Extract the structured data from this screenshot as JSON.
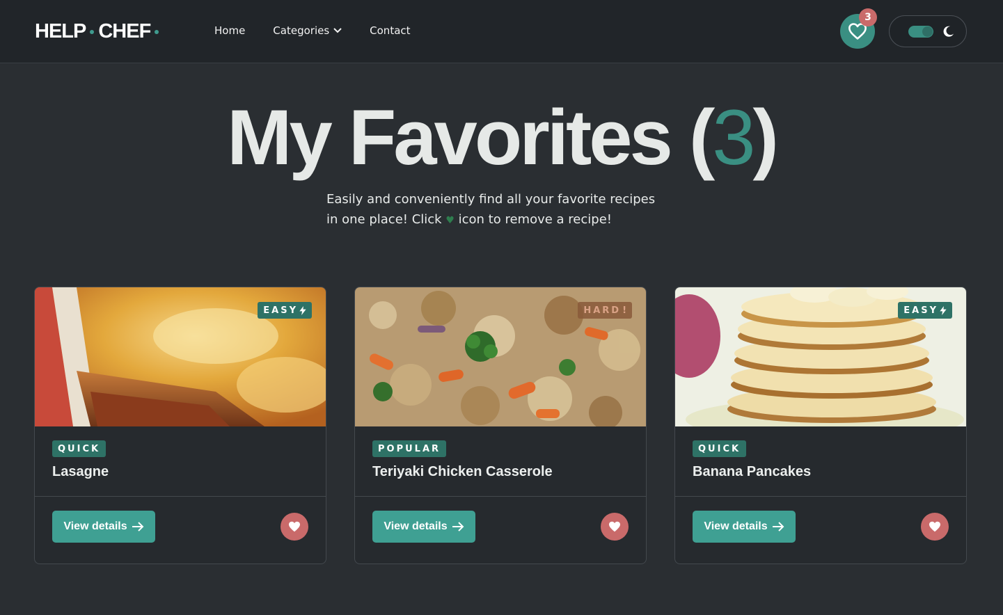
{
  "nav": {
    "logo_part1": "HELP",
    "logo_part2": "CHEF",
    "links": [
      {
        "label": "Home"
      },
      {
        "label": "Categories",
        "has_dropdown": true
      },
      {
        "label": "Contact"
      }
    ],
    "favorites_count": "3",
    "theme": "dark"
  },
  "hero": {
    "title": "My Favorites",
    "open_paren": "(",
    "count": "3",
    "close_paren": ")",
    "subtitle_part1": "Easily and conveniently find all your favorite recipes",
    "subtitle_part2": "in one place! Click",
    "subtitle_part3": "icon to remove a recipe!"
  },
  "recipes": [
    {
      "title": "Lasagne",
      "tag": "QUICK",
      "difficulty": "EASY",
      "button": "View details"
    },
    {
      "title": "Teriyaki Chicken Casserole",
      "tag": "POPULAR",
      "difficulty": "HARD",
      "button": "View details"
    },
    {
      "title": "Banana Pancakes",
      "tag": "QUICK",
      "difficulty": "EASY",
      "button": "View details"
    }
  ],
  "colors": {
    "accent": "#3fa093",
    "background": "#2a2e32",
    "nav": "#212529",
    "heart": "#c96a6a"
  }
}
